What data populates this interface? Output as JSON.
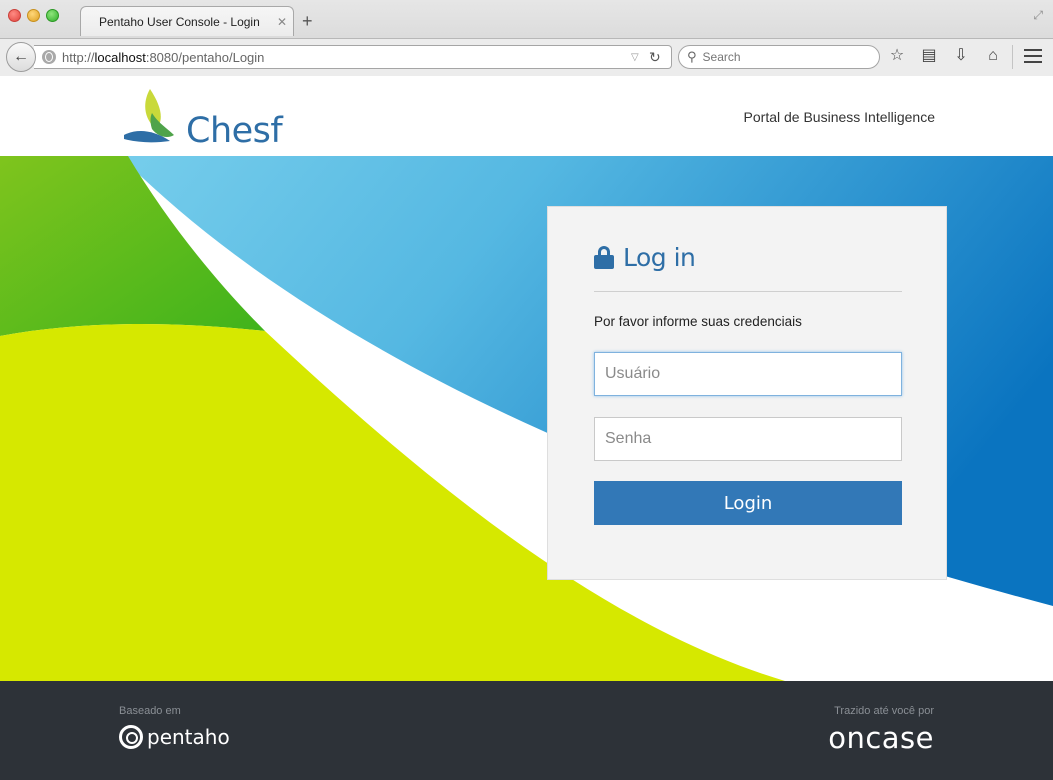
{
  "browser": {
    "tab_title": "Pentaho User Console - Login",
    "tab_close": "✕",
    "new_tab": "+",
    "url_prefix": "http://",
    "url_host": "localhost",
    "url_rest": ":8080/pentaho/Login",
    "search_placeholder": "Search"
  },
  "header": {
    "logo_text": "Chesf",
    "portal_title": "Portal de Business Intelligence"
  },
  "login": {
    "title": "Log in",
    "subtitle": "Por favor informe suas credenciais",
    "username_placeholder": "Usuário",
    "password_placeholder": "Senha",
    "login_button": "Login"
  },
  "footer": {
    "based_on": "Baseado em",
    "pentaho_logo": "pentaho",
    "brought_by": "Trazido até você por",
    "oncase_logo": "oncase"
  },
  "colors": {
    "primary_blue": "#3278b7",
    "hero_lime": "#d6e800",
    "hero_green": "#4fbb1e",
    "footer_bg": "#2d3238"
  },
  "icons": {
    "lock": "lock-icon",
    "back": "back-arrow-icon",
    "reload": "reload-icon",
    "bookmark": "star-icon",
    "reading_list": "clipboard-icon",
    "download": "download-icon",
    "home": "home-icon",
    "menu": "hamburger-menu-icon"
  }
}
